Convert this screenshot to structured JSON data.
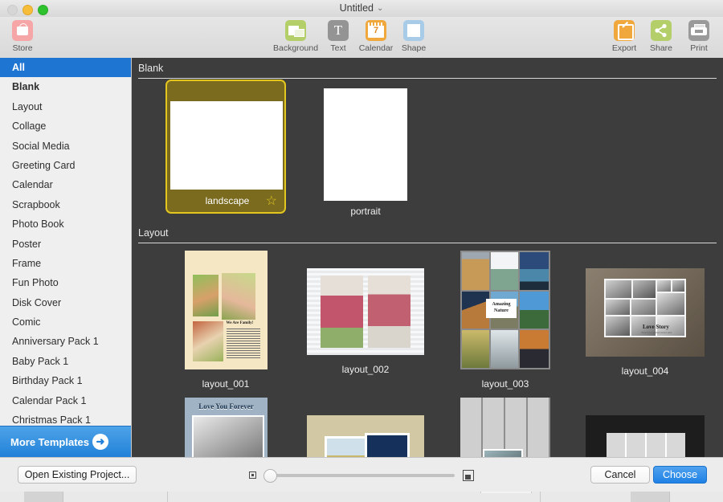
{
  "window": {
    "title": "Untitled",
    "title_chevron": "⌄",
    "traffic_lights": [
      {
        "name": "close",
        "color": "#d6d6d6"
      },
      {
        "name": "minimize",
        "color": "#f6bd3b"
      },
      {
        "name": "maximize",
        "color": "#2fc22f"
      }
    ]
  },
  "toolbar": {
    "left": [
      {
        "label": "Store",
        "icon": "store-bag-icon",
        "color": "#f6a6a6"
      }
    ],
    "center": [
      {
        "label": "Background",
        "icon": "background-icon",
        "color": "#b4cf6a"
      },
      {
        "label": "Text",
        "icon": "text-icon",
        "color": "#949494"
      },
      {
        "label": "Calendar",
        "icon": "calendar-icon",
        "color": "#f0a83c",
        "day": "7"
      },
      {
        "label": "Shape",
        "icon": "shape-icon",
        "color": "#a8cbe8"
      }
    ],
    "right": [
      {
        "label": "Export",
        "icon": "export-icon",
        "color": "#f0a83c"
      },
      {
        "label": "Share",
        "icon": "share-icon",
        "color": "#b4cf6a"
      },
      {
        "label": "Print",
        "icon": "print-icon",
        "color": "#9a9a9a"
      }
    ]
  },
  "sidebar": {
    "selected": "All",
    "items": [
      {
        "label": "All",
        "selected": true,
        "bold": true
      },
      {
        "label": "Blank",
        "selected": false,
        "bold": true
      },
      {
        "label": "Layout",
        "selected": false,
        "bold": false
      },
      {
        "label": "Collage",
        "selected": false,
        "bold": false
      },
      {
        "label": "Social Media",
        "selected": false,
        "bold": false
      },
      {
        "label": "Greeting Card",
        "selected": false,
        "bold": false
      },
      {
        "label": "Calendar",
        "selected": false,
        "bold": false
      },
      {
        "label": "Scrapbook",
        "selected": false,
        "bold": false
      },
      {
        "label": "Photo Book",
        "selected": false,
        "bold": false
      },
      {
        "label": "Poster",
        "selected": false,
        "bold": false
      },
      {
        "label": "Frame",
        "selected": false,
        "bold": false
      },
      {
        "label": "Fun Photo",
        "selected": false,
        "bold": false
      },
      {
        "label": "Disk Cover",
        "selected": false,
        "bold": false
      },
      {
        "label": "Comic",
        "selected": false,
        "bold": false
      },
      {
        "label": "Anniversary Pack 1",
        "selected": false,
        "bold": false
      },
      {
        "label": "Baby Pack 1",
        "selected": false,
        "bold": false
      },
      {
        "label": "Birthday Pack 1",
        "selected": false,
        "bold": false
      },
      {
        "label": "Calendar Pack 1",
        "selected": false,
        "bold": false
      },
      {
        "label": "Christmas Pack 1",
        "selected": false,
        "bold": false
      }
    ],
    "more_templates": {
      "label": "More Templates",
      "arrow_icon": "arrow-right-circle-icon",
      "accent": "#2181d8"
    }
  },
  "content": {
    "sections": [
      {
        "title": "Blank",
        "items": [
          {
            "label": "landscape",
            "selected": true,
            "favorite": true,
            "star_icon": "star-outline-icon"
          },
          {
            "label": "portrait",
            "selected": false,
            "favorite": false
          }
        ]
      },
      {
        "title": "Layout",
        "items": [
          {
            "label": "layout_001",
            "caption": "We Are Family!"
          },
          {
            "label": "layout_002",
            "caption": ""
          },
          {
            "label": "layout_003",
            "caption": "Amazing Nature"
          },
          {
            "label": "layout_004",
            "caption": "Love Story",
            "subcaption": "True love stories never end"
          }
        ]
      }
    ],
    "partial_row": [
      {
        "caption": "Love You Forever"
      },
      {
        "caption": ""
      },
      {
        "caption": ""
      },
      {
        "caption": ""
      }
    ],
    "selection_accent": "#e3c61e"
  },
  "bottom_bar": {
    "open_existing_label": "Open Existing Project...",
    "cancel_label": "Cancel",
    "choose_label": "Choose",
    "choose_accent": "#1f81e5",
    "zoom_slider": {
      "small_icon": "small-thumbnail-icon",
      "large_icon": "large-thumbnail-icon",
      "value_percent": 8
    }
  }
}
